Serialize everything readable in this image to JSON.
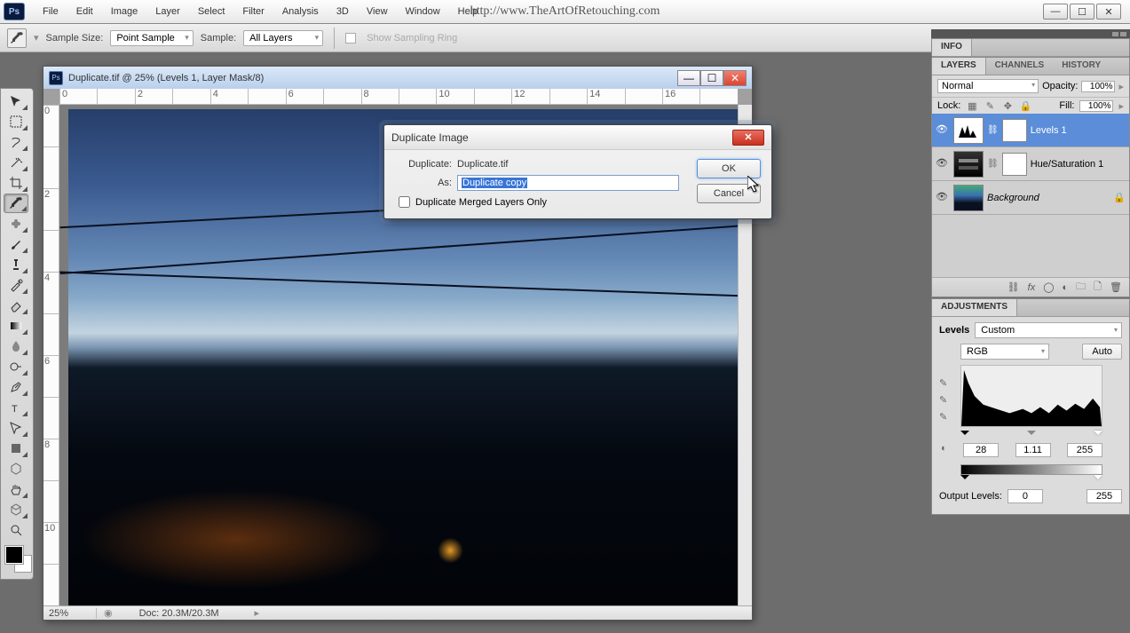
{
  "app": {
    "logo": "Ps",
    "url": "http://www.TheArtOfRetouching.com"
  },
  "menu": [
    "File",
    "Edit",
    "Image",
    "Layer",
    "Select",
    "Filter",
    "Analysis",
    "3D",
    "View",
    "Window",
    "Help"
  ],
  "options": {
    "sample_size_label": "Sample Size:",
    "sample_size_value": "Point Sample",
    "sample_label": "Sample:",
    "sample_value": "All Layers",
    "show_ring": "Show Sampling Ring"
  },
  "document": {
    "title": "Duplicate.tif @ 25% (Levels 1, Layer Mask/8)",
    "zoom": "25%",
    "docinfo": "Doc: 20.3M/20.3M",
    "ruler_h": [
      "0",
      "",
      "2",
      "",
      "4",
      "",
      "6",
      "",
      "8",
      "",
      "10",
      "",
      "12",
      "",
      "14",
      "",
      "16",
      ""
    ],
    "ruler_v": [
      "0",
      "",
      "2",
      "",
      "4",
      "",
      "6",
      "",
      "8",
      "",
      "10",
      ""
    ]
  },
  "dialog": {
    "title": "Duplicate Image",
    "dup_label": "Duplicate:",
    "dup_value": "Duplicate.tif",
    "as_label": "As:",
    "as_value": "Duplicate copy",
    "merge": "Duplicate Merged Layers Only",
    "ok": "OK",
    "cancel": "Cancel"
  },
  "panels": {
    "info": "INFO",
    "layers_tabs": [
      "LAYERS",
      "CHANNELS",
      "HISTORY"
    ],
    "blend": "Normal",
    "opacity_label": "Opacity:",
    "opacity": "100%",
    "lock_label": "Lock:",
    "fill_label": "Fill:",
    "fill": "100%",
    "layers": [
      {
        "name": "Levels 1"
      },
      {
        "name": "Hue/Saturation 1"
      },
      {
        "name": "Background"
      }
    ],
    "adjustments": "ADJUSTMENTS",
    "adj_type": "Levels",
    "adj_preset": "Custom",
    "channel": "RGB",
    "auto": "Auto",
    "in_levels": [
      "28",
      "1.11",
      "255"
    ],
    "out_label": "Output Levels:",
    "out_levels": [
      "0",
      "255"
    ]
  }
}
